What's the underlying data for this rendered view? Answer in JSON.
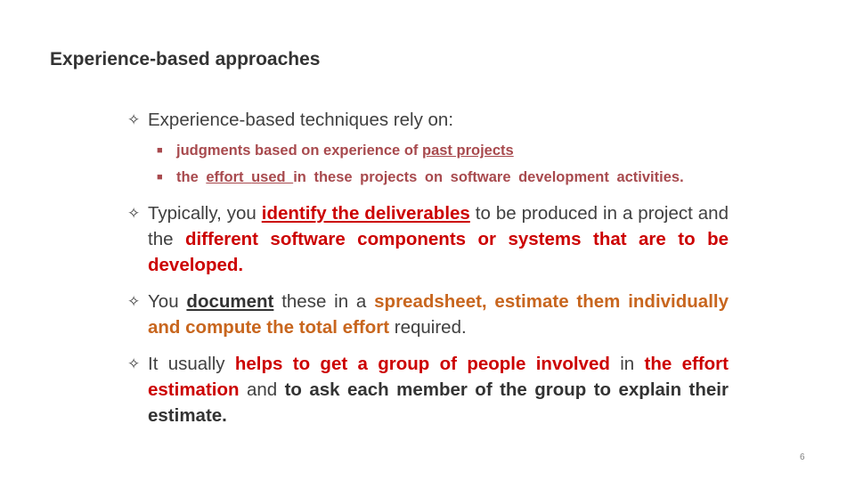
{
  "slide": {
    "title": "Experience-based approaches",
    "page_number": "6",
    "bullet_icon": "four-pointed-star",
    "sub_bullet_icon": "small-square",
    "colors": {
      "body_text": "#404040",
      "title": "#333333",
      "sub_bullet": "#a84a4e",
      "red_emphasis": "#cc0000",
      "orange_emphasis": "#c8661e"
    }
  },
  "bullets": [
    {
      "text": "Experience-based techniques rely on:",
      "sub_bullets": [
        {
          "part1": "judgments based on experience of ",
          "underlined": "past projects"
        },
        {
          "part1": "the ",
          "underlined1": "effort ",
          "part2": " ",
          "underlined2": "used ",
          "part3": " in these projects on software development activities."
        }
      ]
    },
    {
      "part1": "Typically, you ",
      "red_underlined": "identify the deliverables",
      "part2": " to be produced in a project and the ",
      "red": "different software components or systems that are to be developed."
    },
    {
      "part1": "You ",
      "bold_underlined": "document",
      "part2": " these in a ",
      "orange": "spreadsheet, estimate them individually and compute the total effort",
      "part3": " required."
    },
    {
      "part1": "It usually ",
      "red1": "helps to get a group of people involved",
      "part2": " in ",
      "red2": "the effort estimation",
      "part3": " and ",
      "bold": "to ask each member of the group to explain their estimate."
    }
  ]
}
